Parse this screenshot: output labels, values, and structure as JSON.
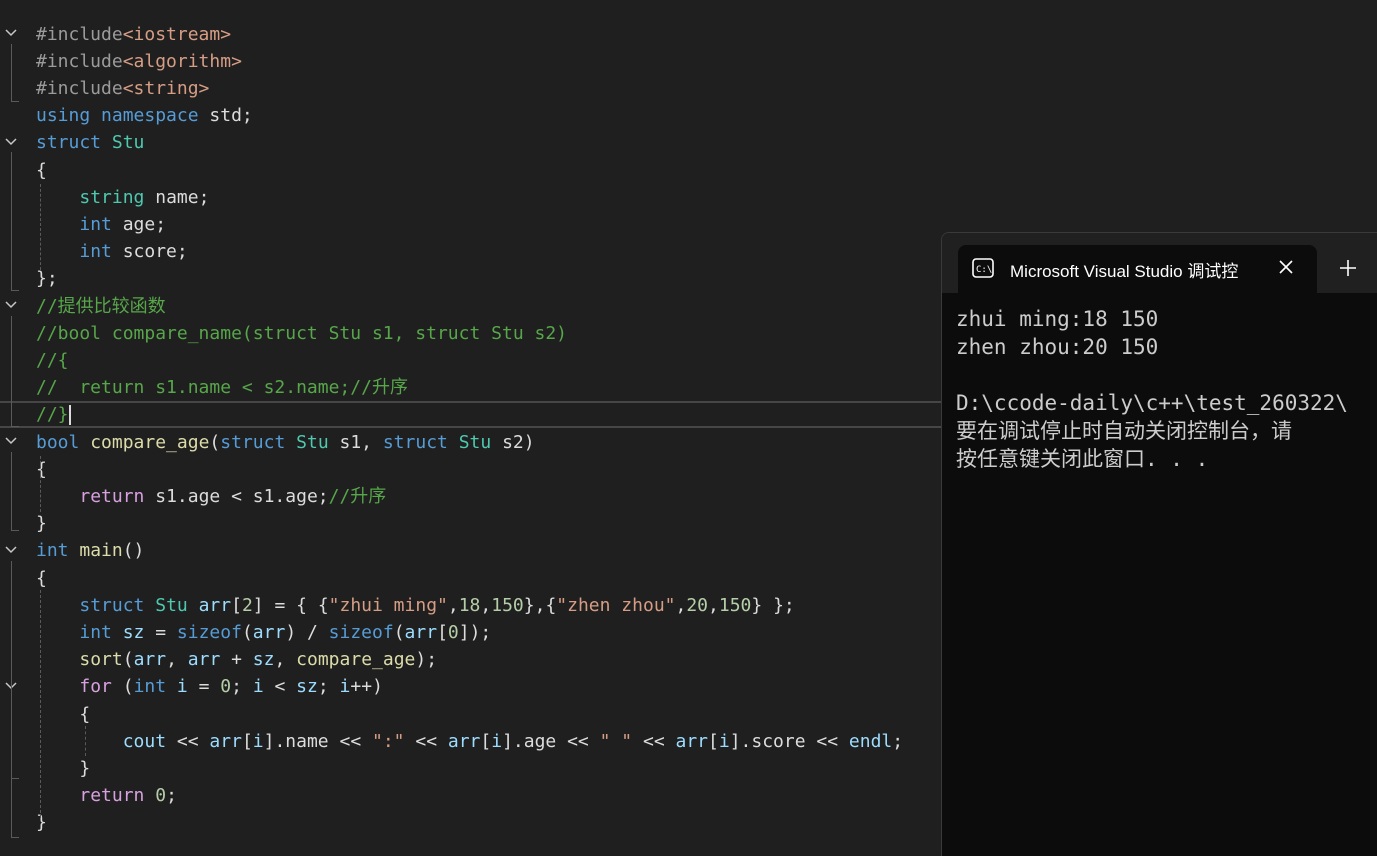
{
  "editor": {
    "lines": [
      [
        [
          "pre",
          "#include"
        ],
        [
          "str",
          "<iostream>"
        ]
      ],
      [
        [
          "pre",
          "#include"
        ],
        [
          "str",
          "<algorithm>"
        ]
      ],
      [
        [
          "pre",
          "#include"
        ],
        [
          "str",
          "<string>"
        ]
      ],
      [
        [
          "kw",
          "using"
        ],
        [
          "plain",
          " "
        ],
        [
          "kw",
          "namespace"
        ],
        [
          "plain",
          " std;"
        ]
      ],
      [
        [
          "kw",
          "struct"
        ],
        [
          "plain",
          " "
        ],
        [
          "type",
          "Stu"
        ]
      ],
      [
        [
          "plain",
          "{"
        ]
      ],
      [
        [
          "plain",
          "    "
        ],
        [
          "type",
          "string"
        ],
        [
          "plain",
          " name;"
        ]
      ],
      [
        [
          "plain",
          "    "
        ],
        [
          "kw",
          "int"
        ],
        [
          "plain",
          " age;"
        ]
      ],
      [
        [
          "plain",
          "    "
        ],
        [
          "kw",
          "int"
        ],
        [
          "plain",
          " score;"
        ]
      ],
      [
        [
          "plain",
          "};"
        ]
      ],
      [
        [
          "com",
          "//提供比较函数"
        ]
      ],
      [
        [
          "com",
          "//bool compare_name(struct Stu s1, struct Stu s2)"
        ]
      ],
      [
        [
          "com",
          "//{"
        ]
      ],
      [
        [
          "com",
          "//  return s1.name < s2.name;//升序"
        ]
      ],
      [
        [
          "com",
          "//}"
        ]
      ],
      [
        [
          "kw",
          "bool"
        ],
        [
          "plain",
          " "
        ],
        [
          "fn",
          "compare_age"
        ],
        [
          "plain",
          "("
        ],
        [
          "kw",
          "struct"
        ],
        [
          "plain",
          " "
        ],
        [
          "type",
          "Stu"
        ],
        [
          "plain",
          " s1, "
        ],
        [
          "kw",
          "struct"
        ],
        [
          "plain",
          " "
        ],
        [
          "type",
          "Stu"
        ],
        [
          "plain",
          " s2)"
        ]
      ],
      [
        [
          "plain",
          "{"
        ]
      ],
      [
        [
          "plain",
          "    "
        ],
        [
          "ctl",
          "return"
        ],
        [
          "plain",
          " s1.age < s1.age;"
        ],
        [
          "com",
          "//升序"
        ]
      ],
      [
        [
          "plain",
          "}"
        ]
      ],
      [
        [
          "kw",
          "int"
        ],
        [
          "plain",
          " "
        ],
        [
          "fn",
          "main"
        ],
        [
          "plain",
          "()"
        ]
      ],
      [
        [
          "plain",
          "{"
        ]
      ],
      [
        [
          "plain",
          "    "
        ],
        [
          "kw",
          "struct"
        ],
        [
          "plain",
          " "
        ],
        [
          "type",
          "Stu"
        ],
        [
          "plain",
          " "
        ],
        [
          "var",
          "arr"
        ],
        [
          "plain",
          "["
        ],
        [
          "num",
          "2"
        ],
        [
          "plain",
          "] = { {"
        ],
        [
          "str",
          "\"zhui ming\""
        ],
        [
          "plain",
          ","
        ],
        [
          "num",
          "18"
        ],
        [
          "plain",
          ","
        ],
        [
          "num",
          "150"
        ],
        [
          "plain",
          "},{"
        ],
        [
          "str",
          "\"zhen zhou\""
        ],
        [
          "plain",
          ","
        ],
        [
          "num",
          "20"
        ],
        [
          "plain",
          ","
        ],
        [
          "num",
          "150"
        ],
        [
          "plain",
          "} };"
        ]
      ],
      [
        [
          "plain",
          "    "
        ],
        [
          "kw",
          "int"
        ],
        [
          "plain",
          " "
        ],
        [
          "var",
          "sz"
        ],
        [
          "plain",
          " = "
        ],
        [
          "kw",
          "sizeof"
        ],
        [
          "plain",
          "("
        ],
        [
          "var",
          "arr"
        ],
        [
          "plain",
          ") / "
        ],
        [
          "kw",
          "sizeof"
        ],
        [
          "plain",
          "("
        ],
        [
          "var",
          "arr"
        ],
        [
          "plain",
          "["
        ],
        [
          "num",
          "0"
        ],
        [
          "plain",
          "]);"
        ]
      ],
      [
        [
          "plain",
          "    "
        ],
        [
          "fn",
          "sort"
        ],
        [
          "plain",
          "("
        ],
        [
          "var",
          "arr"
        ],
        [
          "plain",
          ", "
        ],
        [
          "var",
          "arr"
        ],
        [
          "plain",
          " + "
        ],
        [
          "var",
          "sz"
        ],
        [
          "plain",
          ", "
        ],
        [
          "fn",
          "compare_age"
        ],
        [
          "plain",
          ");"
        ]
      ],
      [
        [
          "plain",
          "    "
        ],
        [
          "ctl",
          "for"
        ],
        [
          "plain",
          " ("
        ],
        [
          "kw",
          "int"
        ],
        [
          "plain",
          " "
        ],
        [
          "var",
          "i"
        ],
        [
          "plain",
          " = "
        ],
        [
          "num",
          "0"
        ],
        [
          "plain",
          "; "
        ],
        [
          "var",
          "i"
        ],
        [
          "plain",
          " < "
        ],
        [
          "var",
          "sz"
        ],
        [
          "plain",
          "; "
        ],
        [
          "var",
          "i"
        ],
        [
          "plain",
          "++)"
        ]
      ],
      [
        [
          "plain",
          "    {"
        ]
      ],
      [
        [
          "plain",
          "        "
        ],
        [
          "var",
          "cout"
        ],
        [
          "plain",
          " << "
        ],
        [
          "var",
          "arr"
        ],
        [
          "plain",
          "["
        ],
        [
          "var",
          "i"
        ],
        [
          "plain",
          "].name << "
        ],
        [
          "str",
          "\":\""
        ],
        [
          "plain",
          " << "
        ],
        [
          "var",
          "arr"
        ],
        [
          "plain",
          "["
        ],
        [
          "var",
          "i"
        ],
        [
          "plain",
          "].age << "
        ],
        [
          "str",
          "\" \""
        ],
        [
          "plain",
          " << "
        ],
        [
          "var",
          "arr"
        ],
        [
          "plain",
          "["
        ],
        [
          "var",
          "i"
        ],
        [
          "plain",
          "].score << "
        ],
        [
          "var",
          "endl"
        ],
        [
          "plain",
          ";"
        ]
      ],
      [
        [
          "plain",
          "    }"
        ]
      ],
      [
        [
          "plain",
          "    "
        ],
        [
          "ctl",
          "return"
        ],
        [
          "plain",
          " "
        ],
        [
          "num",
          "0"
        ],
        [
          "plain",
          ";"
        ]
      ],
      [
        [
          "plain",
          "}"
        ]
      ]
    ]
  },
  "console": {
    "tab_title": "Microsoft Visual Studio 调试控",
    "tab_icon": "terminal-icon",
    "close_icon": "close-icon",
    "new_tab_icon": "plus-icon",
    "output": "zhui ming:18 150\nzhen zhou:20 150\n\nD:\\ccode-daily\\c++\\test_260322\\\n要在调试停止时自动关闭控制台，请\n按任意键关闭此窗口. . ."
  }
}
